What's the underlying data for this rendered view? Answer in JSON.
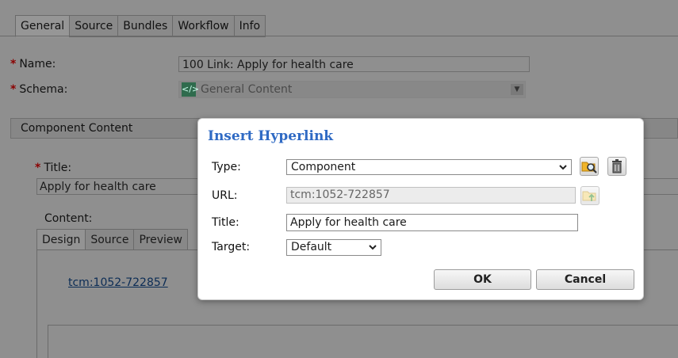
{
  "page": {
    "tabs": [
      "General",
      "Source",
      "Bundles",
      "Workflow",
      "Info"
    ],
    "active_tab": "General",
    "required_marker": "*",
    "name_label": "Name:",
    "name_value": "100 Link: Apply for health care",
    "schema_label": "Schema:",
    "schema_value": "General Content",
    "section_title": "Component Content",
    "title_label": "Title:",
    "title_value": "Apply for health care",
    "content_label": "Content:",
    "editor_tabs": [
      "Design",
      "Source",
      "Preview"
    ],
    "editor_link_text": "tcm:1052-722857"
  },
  "dialog": {
    "title": "Insert Hyperlink",
    "type_label": "Type:",
    "type_value": "Component",
    "url_label": "URL:",
    "url_value": "tcm:1052-722857",
    "title_label": "Title:",
    "title_value": "Apply for health care",
    "target_label": "Target:",
    "target_value": "Default",
    "ok_label": "OK",
    "cancel_label": "Cancel"
  },
  "icons": {
    "browse": "folder-search-icon",
    "delete": "trash-icon",
    "url_browse": "folder-up-icon",
    "schema": "schema-code-icon"
  },
  "colors": {
    "dialog_title": "#2f6ac4",
    "overlay": "#8f8f8f",
    "link": "#0b2c55",
    "required": "#8b0000"
  }
}
